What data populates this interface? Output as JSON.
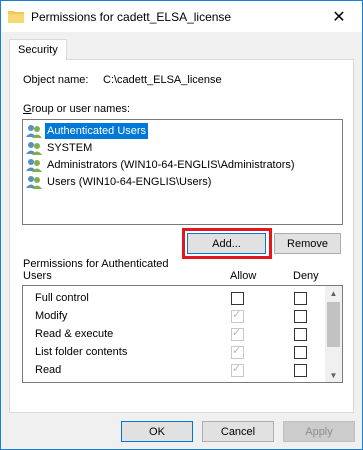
{
  "window": {
    "title": "Permissions for cadett_ELSA_license",
    "close_glyph": "✕"
  },
  "tab": {
    "label": "Security"
  },
  "object": {
    "label": "Object name:",
    "value": "C:\\cadett_ELSA_license"
  },
  "groups": {
    "label_prefix": "G",
    "label_rest": "roup or user names:",
    "items": [
      {
        "name": "Authenticated Users",
        "selected": true
      },
      {
        "name": "SYSTEM",
        "selected": false
      },
      {
        "name": "Administrators (WIN10-64-ENGLIS\\Administrators)",
        "selected": false
      },
      {
        "name": "Users (WIN10-64-ENGLIS\\Users)",
        "selected": false
      }
    ]
  },
  "buttons": {
    "add": "Add...",
    "remove": "Remove",
    "ok": "OK",
    "cancel": "Cancel",
    "apply": "Apply"
  },
  "permissions": {
    "label_line1": "Permissions for Authenticated",
    "label_line2": "Users",
    "allow_header": "Allow",
    "deny_header": "Deny",
    "rows": [
      {
        "name": "Full control",
        "allow": false,
        "allow_disabled": false,
        "deny": false
      },
      {
        "name": "Modify",
        "allow": true,
        "allow_disabled": true,
        "deny": false
      },
      {
        "name": "Read & execute",
        "allow": true,
        "allow_disabled": true,
        "deny": false
      },
      {
        "name": "List folder contents",
        "allow": true,
        "allow_disabled": true,
        "deny": false
      },
      {
        "name": "Read",
        "allow": true,
        "allow_disabled": true,
        "deny": false
      }
    ]
  },
  "colors": {
    "accent": "#0078d7",
    "highlight": "#e5161d"
  }
}
